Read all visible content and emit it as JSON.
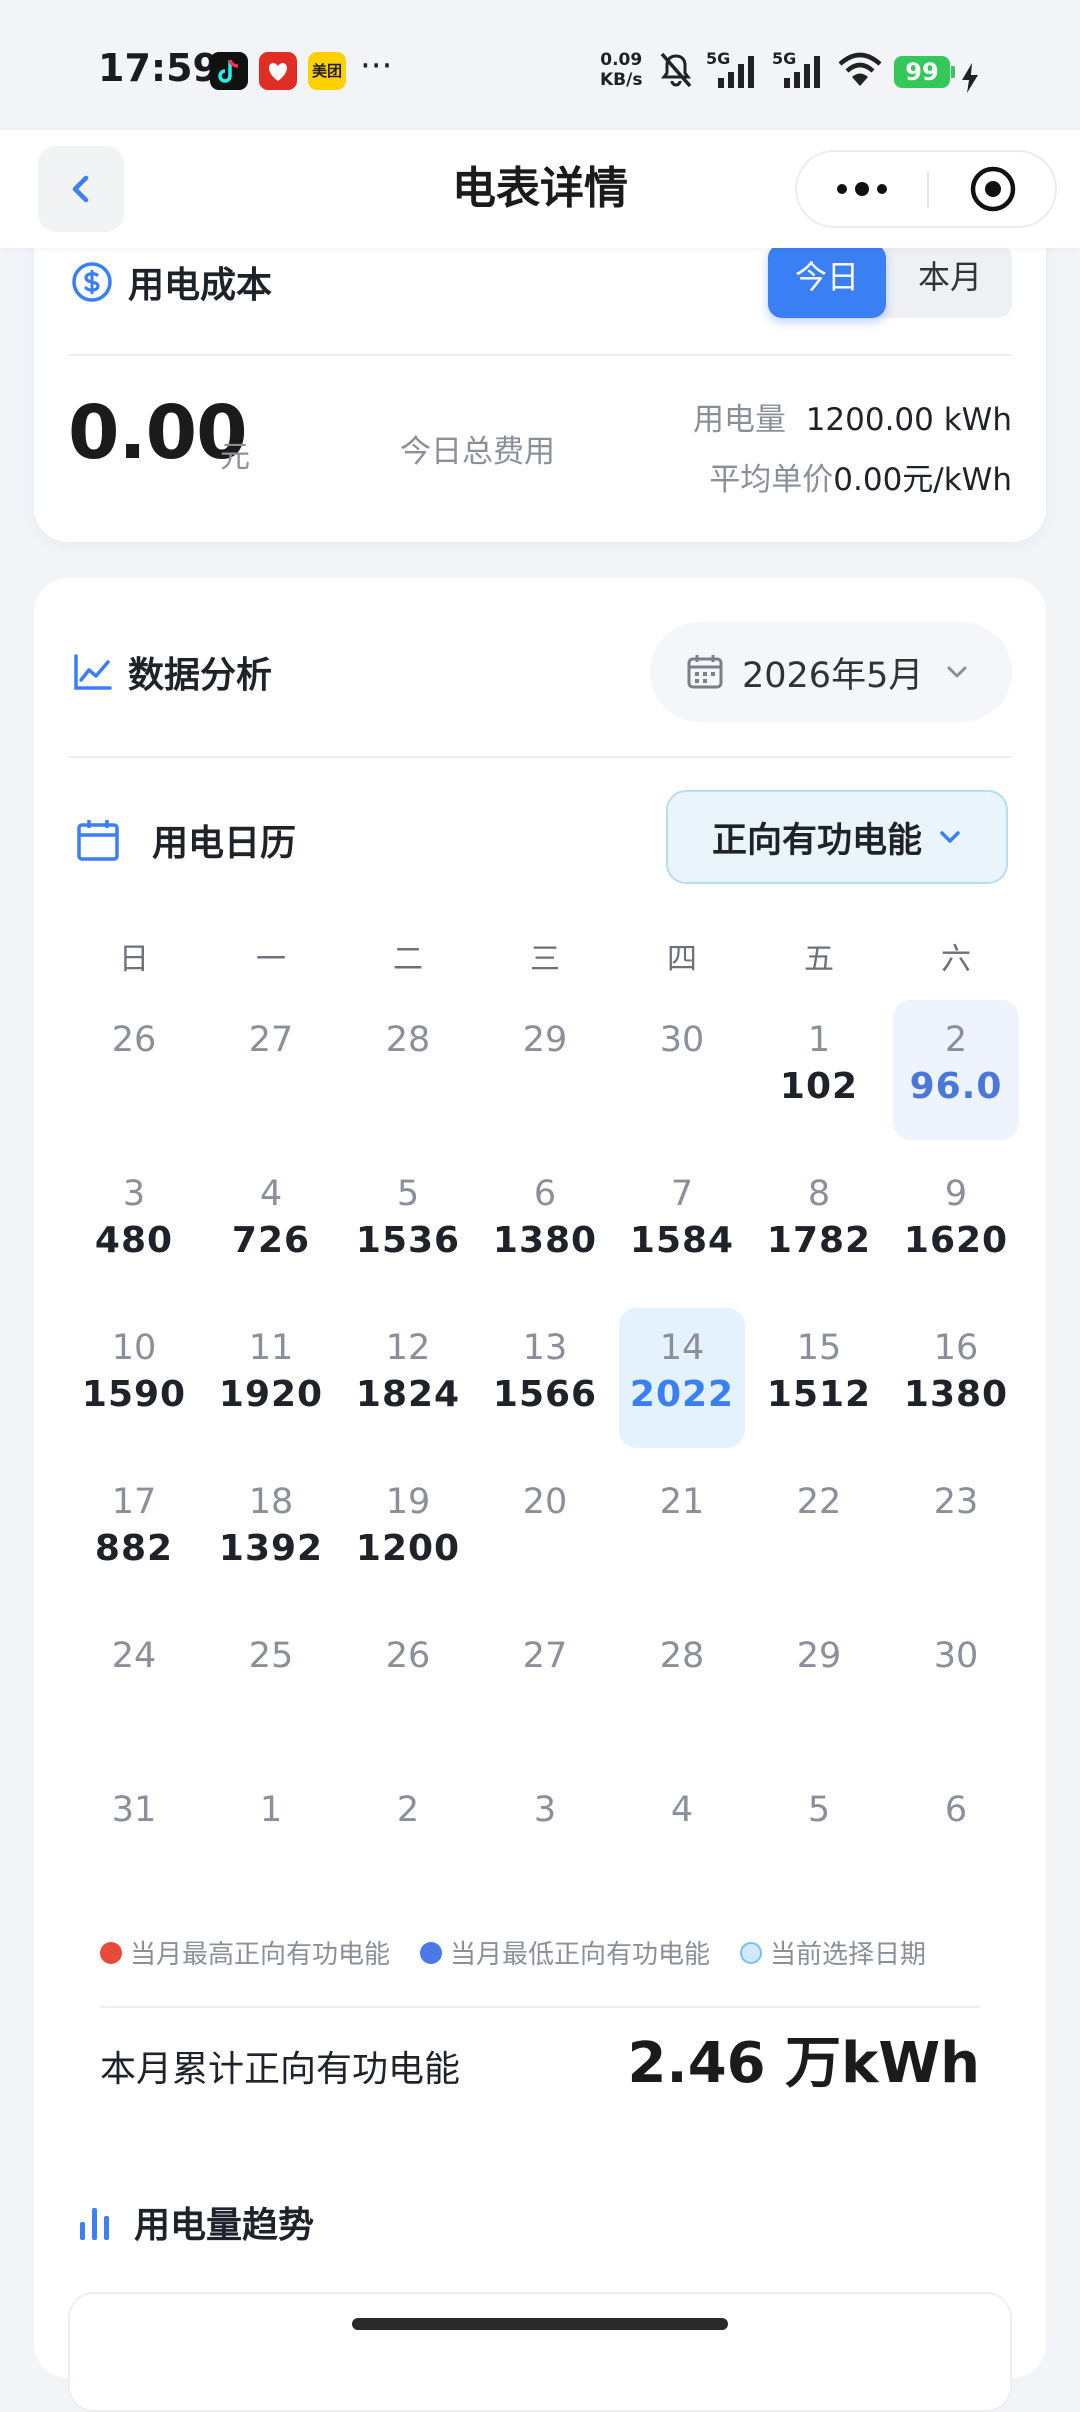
{
  "status_bar": {
    "time": "17:59",
    "meituan": "美团",
    "more": "···",
    "speed_value": "0.09",
    "speed_unit": "KB/s",
    "net1": "5G",
    "net2": "5G",
    "battery": "99"
  },
  "nav": {
    "title": "电表详情"
  },
  "cost": {
    "title": "用电成本",
    "tabs": [
      "今日",
      "本月"
    ],
    "active_tab": "今日",
    "value": "0.00",
    "unit": "元",
    "label": "今日总费用",
    "usage_label": "用电量",
    "usage_value": "1200.00 kWh",
    "avg_label": "平均单价",
    "avg_value": "0.00元/kWh"
  },
  "analysis": {
    "title": "数据分析",
    "month": "2026年5月"
  },
  "calendar": {
    "title": "用电日历",
    "type_select": "正向有功电能",
    "weekdays": [
      "日",
      "一",
      "二",
      "三",
      "四",
      "五",
      "六"
    ],
    "weeks": [
      [
        {
          "d": "26"
        },
        {
          "d": "27"
        },
        {
          "d": "28"
        },
        {
          "d": "29"
        },
        {
          "d": "30"
        },
        {
          "d": "1",
          "v": "102"
        },
        {
          "d": "2",
          "v": "96.0",
          "state": "low"
        }
      ],
      [
        {
          "d": "3",
          "v": "480"
        },
        {
          "d": "4",
          "v": "726"
        },
        {
          "d": "5",
          "v": "1536"
        },
        {
          "d": "6",
          "v": "1380"
        },
        {
          "d": "7",
          "v": "1584"
        },
        {
          "d": "8",
          "v": "1782"
        },
        {
          "d": "9",
          "v": "1620"
        }
      ],
      [
        {
          "d": "10",
          "v": "1590"
        },
        {
          "d": "11",
          "v": "1920"
        },
        {
          "d": "12",
          "v": "1824"
        },
        {
          "d": "13",
          "v": "1566"
        },
        {
          "d": "14",
          "v": "2022",
          "state": "selected"
        },
        {
          "d": "15",
          "v": "1512"
        },
        {
          "d": "16",
          "v": "1380"
        }
      ],
      [
        {
          "d": "17",
          "v": "882"
        },
        {
          "d": "18",
          "v": "1392"
        },
        {
          "d": "19",
          "v": "1200"
        },
        {
          "d": "20"
        },
        {
          "d": "21"
        },
        {
          "d": "22"
        },
        {
          "d": "23"
        }
      ],
      [
        {
          "d": "24"
        },
        {
          "d": "25"
        },
        {
          "d": "26"
        },
        {
          "d": "27"
        },
        {
          "d": "28"
        },
        {
          "d": "29"
        },
        {
          "d": "30"
        }
      ],
      [
        {
          "d": "31"
        },
        {
          "d": "1"
        },
        {
          "d": "2"
        },
        {
          "d": "3"
        },
        {
          "d": "4"
        },
        {
          "d": "5"
        },
        {
          "d": "6"
        }
      ]
    ],
    "legend": [
      {
        "label": "当月最高正向有功电能",
        "color": "#e8493b"
      },
      {
        "label": "当月最低正向有功电能",
        "color": "#4a78e8"
      },
      {
        "label": "当前选择日期",
        "color": "#cfeafc"
      }
    ],
    "total_label": "本月累计正向有功电能",
    "total_value": "2.46 万kWh"
  },
  "trend": {
    "title": "用电量趋势"
  },
  "colors": {
    "accent": "#3b7ff5",
    "low": "#4a78d8",
    "high": "#e8493b"
  }
}
